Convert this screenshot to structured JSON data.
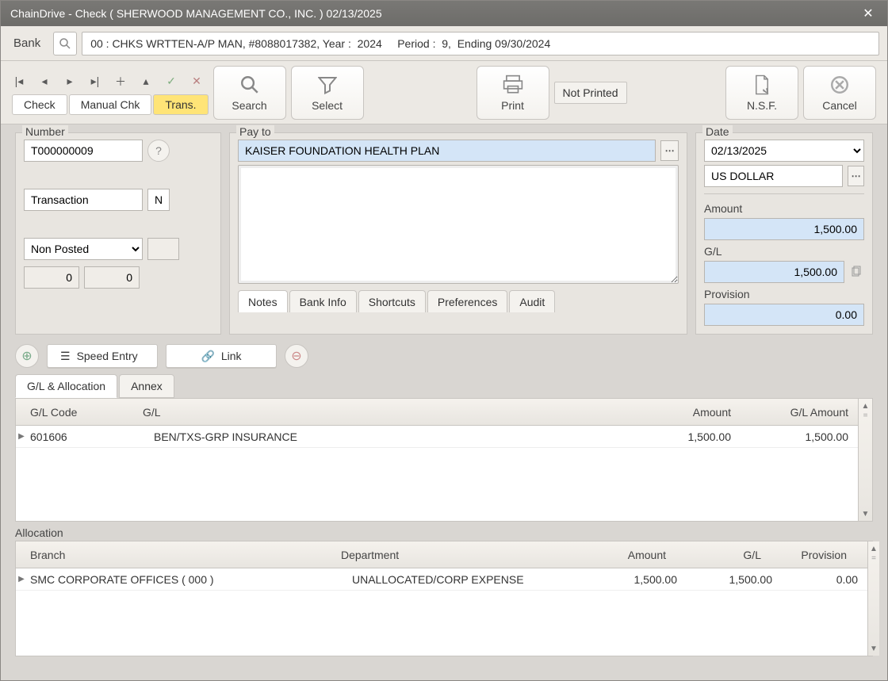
{
  "window": {
    "title": "ChainDrive - Check ( SHERWOOD MANAGEMENT CO., INC. ) 02/13/2025"
  },
  "bank": {
    "label": "Bank",
    "value": "00 : CHKS WRTTEN-A/P MAN, #8088017382, Year :  2024     Period :  9,  Ending 09/30/2024"
  },
  "tabs": {
    "check": "Check",
    "manual": "Manual Chk",
    "trans": "Trans."
  },
  "toolbar": {
    "search": "Search",
    "select": "Select",
    "print": "Print",
    "not_printed": "Not Printed",
    "nsf": "N.S.F.",
    "cancel": "Cancel"
  },
  "number": {
    "legend": "Number",
    "value": "T000000009",
    "txn_label": "Transaction",
    "txn_flag": "N",
    "status": "Non Posted",
    "count1": "0",
    "count2": "0"
  },
  "payto": {
    "legend": "Pay to",
    "value": "KAISER FOUNDATION HEALTH PLAN",
    "tabs": {
      "notes": "Notes",
      "bankinfo": "Bank Info",
      "shortcuts": "Shortcuts",
      "prefs": "Preferences",
      "audit": "Audit"
    }
  },
  "date": {
    "legend": "Date",
    "value": "02/13/2025",
    "currency": "US DOLLAR",
    "amount_lbl": "Amount",
    "amount": "1,500.00",
    "gl_lbl": "G/L",
    "gl": "1,500.00",
    "prov_lbl": "Provision",
    "prov": "0.00"
  },
  "mid_actions": {
    "speed": "Speed Entry",
    "link": "Link"
  },
  "tabs2": {
    "gl": "G/L & Allocation",
    "annex": "Annex"
  },
  "glgrid": {
    "head": {
      "code": "G/L Code",
      "gl": "G/L",
      "amount": "Amount",
      "glamt": "G/L Amount"
    },
    "rows": [
      {
        "code": "601606",
        "gl": "BEN/TXS-GRP INSURANCE",
        "amount": "1,500.00",
        "glamt": "1,500.00"
      }
    ]
  },
  "alloc": {
    "legend": "Allocation",
    "head": {
      "branch": "Branch",
      "dept": "Department",
      "amount": "Amount",
      "gl": "G/L",
      "prov": "Provision"
    },
    "rows": [
      {
        "branch": "SMC CORPORATE OFFICES ( 000 )",
        "dept": "UNALLOCATED/CORP EXPENSE",
        "amount": "1,500.00",
        "gl": "1,500.00",
        "prov": "0.00"
      }
    ]
  }
}
